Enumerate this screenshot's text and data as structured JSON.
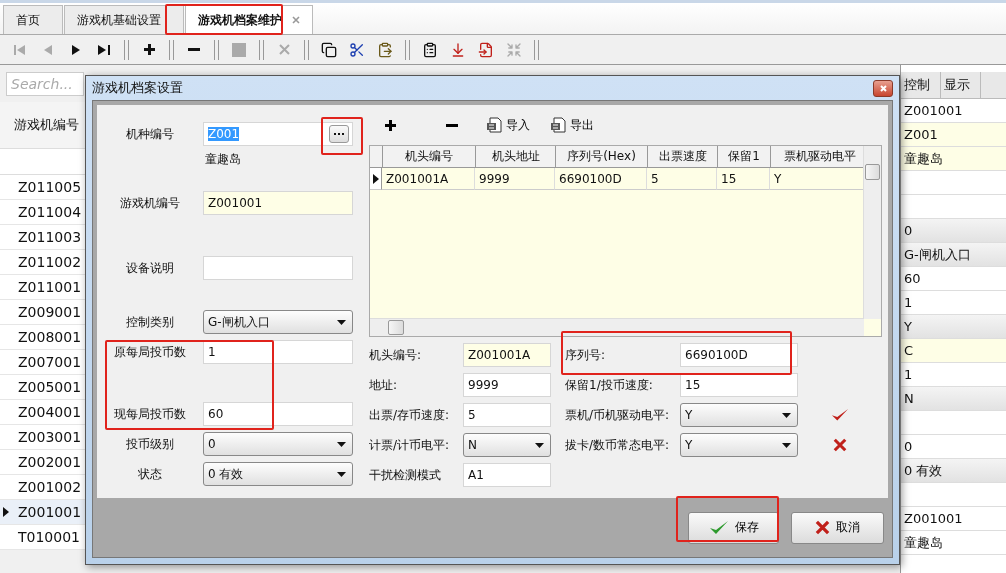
{
  "tabs": [
    {
      "label": "首页",
      "selected": false,
      "closable": false
    },
    {
      "label": "游戏机基础设置",
      "selected": false,
      "closable": false
    },
    {
      "label": "游戏机档案维护",
      "selected": true,
      "closable": true
    }
  ],
  "toolbar": [
    {
      "kind": "first",
      "disabled": true
    },
    {
      "kind": "prev",
      "disabled": true
    },
    {
      "kind": "next",
      "disabled": false
    },
    {
      "kind": "last",
      "disabled": false
    },
    {
      "kind": "sep"
    },
    {
      "kind": "add",
      "disabled": false
    },
    {
      "kind": "sep"
    },
    {
      "kind": "remove",
      "disabled": false
    },
    {
      "kind": "sep"
    },
    {
      "kind": "stop",
      "disabled": true
    },
    {
      "kind": "sep"
    },
    {
      "kind": "cancel",
      "disabled": true
    },
    {
      "kind": "sep"
    },
    {
      "kind": "copy",
      "disabled": false
    },
    {
      "kind": "cut",
      "disabled": false
    },
    {
      "kind": "paste",
      "disabled": false
    },
    {
      "kind": "sep"
    },
    {
      "kind": "form",
      "disabled": false
    },
    {
      "kind": "move",
      "disabled": false
    },
    {
      "kind": "import",
      "disabled": false
    },
    {
      "kind": "shrink",
      "disabled": true
    },
    {
      "kind": "sep"
    }
  ],
  "list": {
    "search_placeholder": "Search...",
    "column": "游戏机编号",
    "rows": [
      {
        "id": "Z011005",
        "selected": false
      },
      {
        "id": "Z011004",
        "selected": false
      },
      {
        "id": "Z011003",
        "selected": false
      },
      {
        "id": "Z011002",
        "selected": false
      },
      {
        "id": "Z011001",
        "selected": false
      },
      {
        "id": "Z009001",
        "selected": false
      },
      {
        "id": "Z008001",
        "selected": false
      },
      {
        "id": "Z007001",
        "selected": false
      },
      {
        "id": "Z005001",
        "selected": false
      },
      {
        "id": "Z004001",
        "selected": false
      },
      {
        "id": "Z003001",
        "selected": false
      },
      {
        "id": "Z002001",
        "selected": false
      },
      {
        "id": "Z001002",
        "selected": false
      },
      {
        "id": "Z001001",
        "selected": true
      },
      {
        "id": "T010001",
        "selected": false
      }
    ]
  },
  "side_panel": {
    "tabs": [
      "控制",
      "显示"
    ],
    "rows": [
      {
        "kind": "text",
        "value": "Z001001"
      },
      {
        "kind": "highlight",
        "value": "Z001"
      },
      {
        "kind": "highlight",
        "value": "童趣岛"
      },
      {
        "kind": "blank"
      },
      {
        "kind": "blank"
      },
      {
        "kind": "select",
        "value": "0"
      },
      {
        "kind": "select",
        "value": "G-闸机入口"
      },
      {
        "kind": "text",
        "value": "60"
      },
      {
        "kind": "text",
        "value": "1"
      },
      {
        "kind": "select",
        "value": "Y"
      },
      {
        "kind": "highlight",
        "value": "C"
      },
      {
        "kind": "text",
        "value": "1"
      },
      {
        "kind": "select",
        "value": "N"
      },
      {
        "kind": "blank"
      },
      {
        "kind": "text",
        "value": "0"
      },
      {
        "kind": "select",
        "value": "0  有效"
      },
      {
        "kind": "blank"
      },
      {
        "kind": "text",
        "value": "Z001001"
      },
      {
        "kind": "text",
        "value": "童趣岛"
      }
    ]
  },
  "dialog": {
    "title": "游戏机档案设置",
    "main_fields": [
      {
        "label": "机种编号",
        "kind": "lookup",
        "value": "Z001",
        "value_selected": true,
        "note": "童趣岛"
      },
      {
        "label": "游戏机编号",
        "kind": "text",
        "value": "Z001001",
        "highlighted": true
      },
      {
        "label": "设备说明",
        "kind": "text",
        "highlighted": false
      },
      {
        "label": "控制类别",
        "kind": "select",
        "value": "G-闸机入口"
      },
      {
        "label": "原每局投币数",
        "kind": "text",
        "value": "1",
        "highlighted": false
      },
      {
        "label": "现每局投币数",
        "kind": "text",
        "value": "60",
        "highlighted": false
      },
      {
        "label": "投币级别",
        "kind": "select",
        "value": "0"
      },
      {
        "label": "状态",
        "kind": "select",
        "value": "0  有效"
      }
    ],
    "grid_toolbar": [
      {
        "kind": "add"
      },
      {
        "kind": "remove"
      },
      {
        "kind": "import",
        "label": "导入"
      },
      {
        "kind": "export",
        "label": "导出"
      }
    ],
    "grid": {
      "columns": [
        "机头编号",
        "机头地址",
        "序列号(Hex)",
        "出票速度",
        "保留1",
        "票机驱动电平"
      ],
      "rows": [
        {
          "selected": true,
          "cells": [
            "Z001001A",
            "9999",
            "6690100D",
            "5",
            "15",
            "Y"
          ]
        }
      ]
    },
    "head_fields": [
      [
        {
          "label": "机头编号:",
          "kind": "text",
          "value": "Z001001A",
          "highlighted": true
        },
        {
          "label": "序列号:",
          "kind": "text",
          "value": "6690100D",
          "highlighted": false
        }
      ],
      [
        {
          "label": "地址:",
          "kind": "text",
          "value": "9999",
          "highlighted": false
        },
        {
          "label": "保留1/投币速度:",
          "kind": "text",
          "value": "15",
          "highlighted": false
        }
      ],
      [
        {
          "label": "出票/存币速度:",
          "kind": "text",
          "value": "5",
          "highlighted": false
        },
        {
          "label": "票机/币机驱动电平:",
          "kind": "select",
          "value": "Y",
          "valid": true
        }
      ],
      [
        {
          "label": "计票/计币电平:",
          "kind": "select",
          "value": "N"
        },
        {
          "label": "拔卡/数币常态电平:",
          "kind": "select",
          "value": "Y",
          "valid": false
        }
      ],
      [
        {
          "label": "干扰检测模式",
          "kind": "text",
          "value": "A1",
          "highlighted": false
        }
      ]
    ],
    "buttons": [
      {
        "kind": "save",
        "label": "保存"
      },
      {
        "kind": "cancel",
        "label": "取消"
      }
    ]
  }
}
